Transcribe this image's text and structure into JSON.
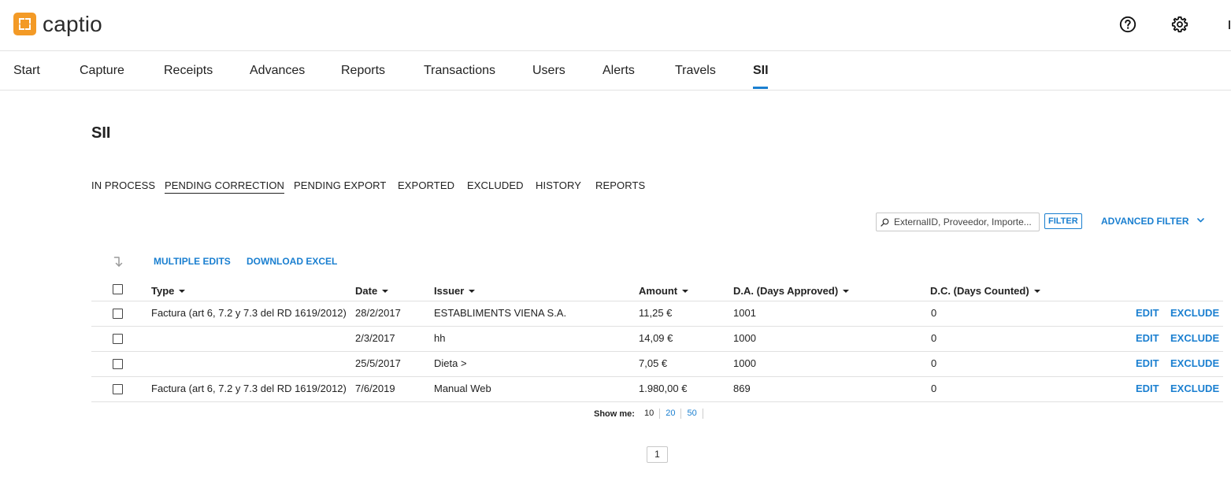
{
  "app": {
    "name": "captio",
    "brand_color": "#f39a26",
    "accent_color": "#1a7fd0"
  },
  "header": {
    "help_icon": "help-circle-icon",
    "settings_icon": "gear-icon"
  },
  "nav": {
    "items": [
      {
        "label": "Start"
      },
      {
        "label": "Capture"
      },
      {
        "label": "Receipts"
      },
      {
        "label": "Advances"
      },
      {
        "label": "Reports"
      },
      {
        "label": "Transactions"
      },
      {
        "label": "Users"
      },
      {
        "label": "Alerts"
      },
      {
        "label": "Travels"
      },
      {
        "label": "SII",
        "active": true
      }
    ]
  },
  "page": {
    "title": "SII"
  },
  "subtabs": [
    {
      "label": "IN PROCESS"
    },
    {
      "label": "PENDING CORRECTION",
      "active": true
    },
    {
      "label": "PENDING EXPORT"
    },
    {
      "label": "EXPORTED"
    },
    {
      "label": "EXCLUDED"
    },
    {
      "label": "HISTORY"
    },
    {
      "label": "REPORTS"
    }
  ],
  "search": {
    "placeholder": "ExternalID, Proveedor, Importe...",
    "filter_label": "FILTER",
    "advanced_filter_label": "ADVANCED FILTER"
  },
  "actions": {
    "multiple_edits": "MULTIPLE EDITS",
    "download_excel": "DOWNLOAD EXCEL"
  },
  "table": {
    "columns": [
      "Type",
      "Date",
      "Issuer",
      "Amount",
      "D.A. (Days Approved)",
      "D.C. (Days Counted)"
    ],
    "rows": [
      {
        "type": "Factura (art 6, 7.2 y 7.3 del RD 1619/2012)",
        "date": "28/2/2017",
        "issuer": "ESTABLIMENTS VIENA S.A.",
        "amount": "11,25 €",
        "da": "1001",
        "dc": "0"
      },
      {
        "type": "",
        "date": "2/3/2017",
        "issuer": "hh",
        "amount": "14,09 €",
        "da": "1000",
        "dc": "0"
      },
      {
        "type": "",
        "date": "25/5/2017",
        "issuer": "Dieta >",
        "amount": "7,05 €",
        "da": "1000",
        "dc": "0"
      },
      {
        "type": "Factura (art 6, 7.2 y 7.3 del RD 1619/2012)",
        "date": "7/6/2019",
        "issuer": "Manual Web",
        "amount": "1.980,00 €",
        "da": "869",
        "dc": "0"
      }
    ],
    "row_actions": {
      "edit": "EDIT",
      "exclude": "EXCLUDE"
    }
  },
  "pagination": {
    "show_me_label": "Show me:",
    "options": [
      "10",
      "20",
      "50"
    ],
    "current_option": "10",
    "current_page": "1"
  }
}
